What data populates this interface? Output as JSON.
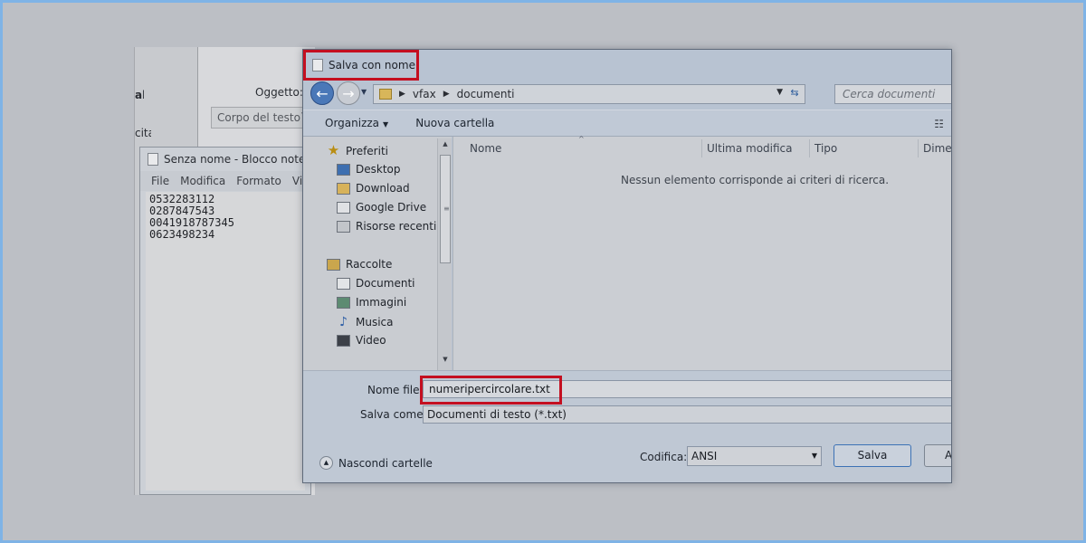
{
  "email_window": {
    "left_text_1": "ali",
    "left_text_2": "cita",
    "subject_label": "Oggetto:",
    "body_combo": "Corpo del testo"
  },
  "notepad": {
    "title": "Senza nome - Blocco note",
    "menu": [
      "File",
      "Modifica",
      "Formato",
      "Vi"
    ],
    "lines": [
      "0532283112",
      "0287847543",
      "0041918787345",
      "0623498234"
    ]
  },
  "dialog": {
    "title": "Salva con nome",
    "breadcrumb": [
      "vfax",
      "documenti"
    ],
    "search_placeholder": "Cerca documenti",
    "toolbar": {
      "organize": "Organizza",
      "new_folder": "Nuova cartella"
    },
    "nav": {
      "favorites_header": "Preferiti",
      "favorites": [
        "Desktop",
        "Download",
        "Google Drive",
        "Risorse recenti"
      ],
      "libraries_header": "Raccolte",
      "libraries": [
        "Documenti",
        "Immagini",
        "Musica",
        "Video"
      ]
    },
    "columns": [
      "Nome",
      "Ultima modifica",
      "Tipo",
      "Dimen"
    ],
    "empty_message": "Nessun elemento corrisponde ai criteri di ricerca.",
    "filename_label": "Nome file:",
    "filename_value": "numeripercircolare.txt",
    "savetype_label": "Salva come:",
    "savetype_value": "Documenti di testo (*.txt)",
    "hide_folders": "Nascondi cartelle",
    "encoding_label": "Codifica:",
    "encoding_value": "ANSI",
    "save_button": "Salva",
    "cancel_button": "A"
  },
  "colors": {
    "highlight": "#c40f20",
    "frame": "#7fb3e6"
  }
}
